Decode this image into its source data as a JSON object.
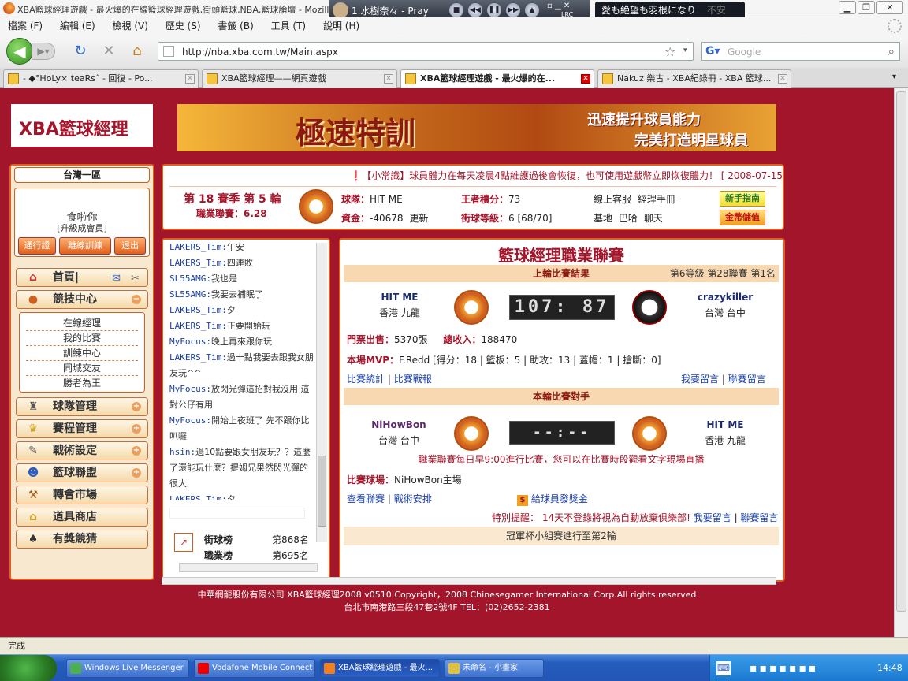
{
  "browser": {
    "window_title": "XBA籃球經理遊戲 - 最火爆的在線籃球經理遊戲,街頭籃球,NBA,籃球論壇 - Mozilla Firefox",
    "menu": [
      "檔案 (F)",
      "編輯 (E)",
      "檢視 (V)",
      "歷史 (S)",
      "書籤 (B)",
      "工具 (T)",
      "說明 (H)"
    ],
    "url": "http://nba.xba.com.tw/Main.aspx",
    "search_placeholder": "Google",
    "search_engine_icon": "google-icon",
    "tabs": [
      {
        "label": "- ◆°HoLy× teaRs˝ - 回復 - Po...",
        "active": false
      },
      {
        "label": "XBA籃球經理——網頁遊戲",
        "active": false
      },
      {
        "label": "XBA籃球經理遊戲 - 最火爆的在...",
        "active": true
      },
      {
        "label": "Nakuz 樂古 - XBA紀錄冊 - XBA 籃球...",
        "active": false
      }
    ],
    "status": "完成"
  },
  "player": {
    "track": "1.水樹奈々 - Pray",
    "lyric": "愛も絶望も羽根になり",
    "lyric_suffix": "不安",
    "lrc_label": "LRC"
  },
  "site": {
    "logo": "XBA籃球經理",
    "banner_title": "極速特訓",
    "banner_line1": "迅速提升球員能力",
    "banner_line2": "完美打造明星球員"
  },
  "left": {
    "server": "台灣一區",
    "username": "食啦你",
    "member_level": "[升級成會員]",
    "buttons": [
      "通行證",
      "離線訓練",
      "退出"
    ],
    "home": "首頁|",
    "arena": "競技中心",
    "arena_sub": [
      "在線經理",
      "我的比賽",
      "訓練中心",
      "同城交友",
      "勝者為王"
    ],
    "menu": [
      "球隊管理",
      "賽程管理",
      "戰術設定",
      "籃球聯盟",
      "轉會市場",
      "道具商店",
      "有獎競猜"
    ]
  },
  "info": {
    "news": "❗【小常識】球員體力在每天凌晨4點維護過後會恢復，也可使用遊戲幣立即恢復體力！ [ 2008-07-15",
    "season": "第 18 賽季 第 5 輪",
    "league": "職業聯賽：6.28",
    "team_label": "球隊：",
    "team": "HIT ME",
    "funds_label": "資金：",
    "funds": "-40678",
    "update": "更新",
    "points_label": "王者積分：",
    "points": "73",
    "level_label": "街球等級：",
    "level": "6 [68/70]",
    "online": "線上客服",
    "manual": "經理手冊",
    "base": "基地",
    "bar": "巴哈",
    "chat": "聊天",
    "guide_btn": "新手指南",
    "store_btn": "金幣儲值"
  },
  "chat": [
    {
      "name": "LAKERS_Tim:",
      "msg": "午安"
    },
    {
      "name": "LAKERS_Tim:",
      "msg": "四連敗"
    },
    {
      "name": "SL55AMG:",
      "msg": "我也是"
    },
    {
      "name": "SL55AMG:",
      "msg": "我要去補眠了"
    },
    {
      "name": "LAKERS_Tim:",
      "msg": "夕"
    },
    {
      "name": "LAKERS_Tim:",
      "msg": "正要開始玩"
    },
    {
      "name": "MyFocus:",
      "msg": "晚上再來跟你玩"
    },
    {
      "name": "LAKERS_Tim:",
      "msg": "過十點我要去跟我女朋友玩^^"
    },
    {
      "name": "MyFocus:",
      "msg": "放閃光彈這招對我沒用 這對公仔有用"
    },
    {
      "name": "MyFocus:",
      "msg": "開始上夜班了 先不跟你比叭囉"
    },
    {
      "name": "hsin:",
      "msg": "過10點要跟女朋友玩？？這麼了還能玩什麼？提姆兄果然閃光彈的很大"
    },
    {
      "name": "LAKERS_Tim:",
      "msg": "夕"
    }
  ],
  "rank": {
    "street_label": "街球榜",
    "street": "第868名",
    "pro_label": "職業榜",
    "pro": "第695名"
  },
  "main": {
    "title": "籃球經理職業聯賽",
    "last_match_header": "上輪比賽結果",
    "last_match_meta": "第6等級 第28聯賽 第1名",
    "home_team": "HIT ME",
    "home_city": "香港 九龍",
    "score": "107: 87",
    "away_team": "crazykiller",
    "away_city": "台灣 台中",
    "tickets_label": "門票出售：",
    "tickets": "5370張",
    "income_label": "總收入：",
    "income": "188470",
    "mvp_label": "本場MVP：",
    "mvp": "F.Redd [得分：18 | 籃板：5 | 助攻：13 | 蓋帽：1 | 搶斷：0]",
    "link_stats": "比賽統計",
    "link_report": "比賽戰報",
    "link_msg": "我要留言",
    "link_league_msg": "聯賽留言",
    "next_header": "本輪比賽對手",
    "next_home": "NiHowBon",
    "next_home_city": "台灣 台中",
    "next_score": "--:--",
    "next_away": "HIT ME",
    "next_away_city": "香港 九龍",
    "notice": "職業聯賽每日早9:00進行比賽，您可以在比賽時段觀看文字現場直播",
    "venue_label": "比賽球場：",
    "venue": "NiHowBon主場",
    "link_league": "查看聯賽",
    "link_tactics": "戰術安排",
    "bonus": "給球員發獎金",
    "warning": "特別提醒： 14天不登錄將視為自動放棄俱樂部!",
    "cup": "冠軍杯小組賽進行至第2輪"
  },
  "footer": {
    "line1": "中華網龍股份有限公司 XBA籃球經理2008 v0510     Copyright，2008 Chinesegamer International Corp.All rights reserved",
    "line2": "台北市南港路三段47巷2號4F TEL：(02)2652-2381"
  },
  "taskbar": {
    "items": [
      "Windows Live Messenger",
      "Vodafone Mobile Connect ...",
      "XBA籃球經理遊戲 - 最火...",
      "未命名 - 小畫家"
    ],
    "time": "14:48"
  }
}
